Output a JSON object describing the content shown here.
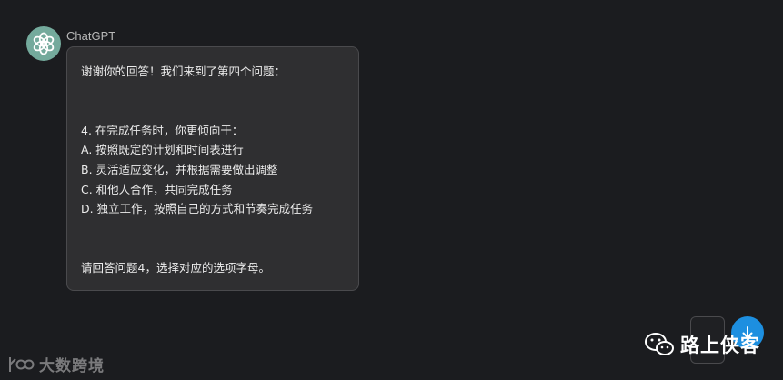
{
  "message": {
    "sender": "ChatGPT",
    "lines": [
      "谢谢你的回答！我们来到了第四个问题：",
      "",
      "",
      "4. 在完成任务时，你更倾向于：",
      "A. 按照既定的计划和时间表进行",
      "B. 灵活适应变化，并根据需要做出调整",
      "C. 和他人合作，共同完成任务",
      "D. 独立工作，按照自己的方式和节奏完成任务",
      "",
      "",
      "请回答问题4，选择对应的选项字母。"
    ]
  },
  "icons": {
    "avatar": "openai-logo-icon",
    "scroll": "arrow-down-icon",
    "wechat": "wechat-icon"
  },
  "watermarks": {
    "left": "大数跨境",
    "right": "路上侠客"
  },
  "colors": {
    "background": "#1b1c1f",
    "bubble": "#2f2f31",
    "avatar": "#74aa9c",
    "accent": "#1d8fe0"
  }
}
